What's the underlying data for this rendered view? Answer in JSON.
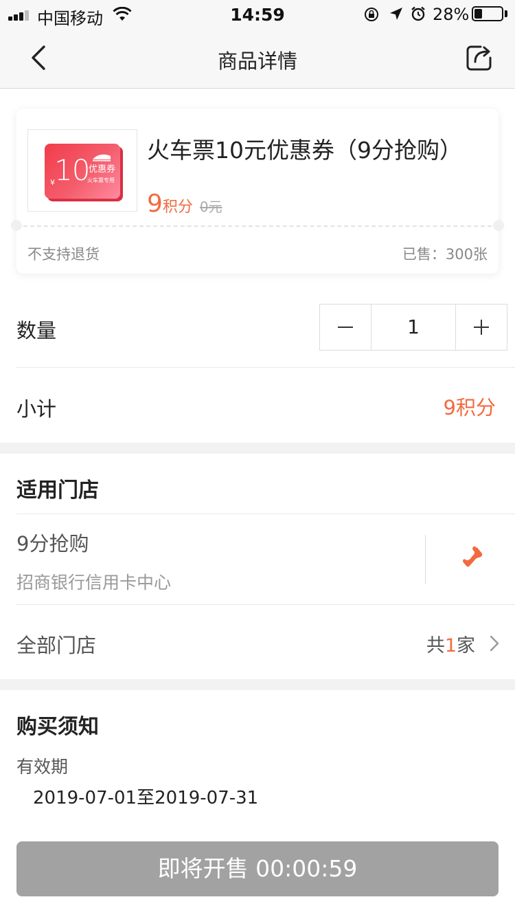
{
  "status_bar": {
    "carrier": "中国移动",
    "time": "14:59",
    "battery": "28%",
    "battery_level": 0.28,
    "icons": [
      "signal-icon",
      "wifi-icon",
      "orientation-lock-icon",
      "location-icon",
      "alarm-icon",
      "battery-icon"
    ]
  },
  "nav": {
    "title": "商品详情",
    "back_icon": "chevron-left-icon",
    "share_icon": "share-icon"
  },
  "product": {
    "title": "火车票10元优惠券（9分抢购）",
    "price_value": "9",
    "price_unit": "积分",
    "original_price": "0元",
    "return_policy": "不支持退货",
    "sold": "已售：300张",
    "image": {
      "currency": "¥",
      "amount": "10",
      "label": "优惠券",
      "sublabel": "火车票专用"
    }
  },
  "quantity": {
    "label": "数量",
    "value": "1"
  },
  "subtotal": {
    "label": "小计",
    "value": "9积分"
  },
  "stores": {
    "title": "适用门店",
    "store_name": "9分抢购",
    "store_address": "招商银行信用卡中心",
    "all_label": "全部门店",
    "count_prefix": "共",
    "count_value": "1",
    "count_suffix": "家"
  },
  "notes": {
    "title": "购买须知",
    "validity_label": "有效期",
    "validity_value": "2019-07-01至2019-07-31"
  },
  "buy_button": {
    "label": "即将开售 00:00:59"
  },
  "colors": {
    "accent": "#f26a3f",
    "button_disabled": "#a2a2a2",
    "section_gap": "#f2f2f2"
  }
}
